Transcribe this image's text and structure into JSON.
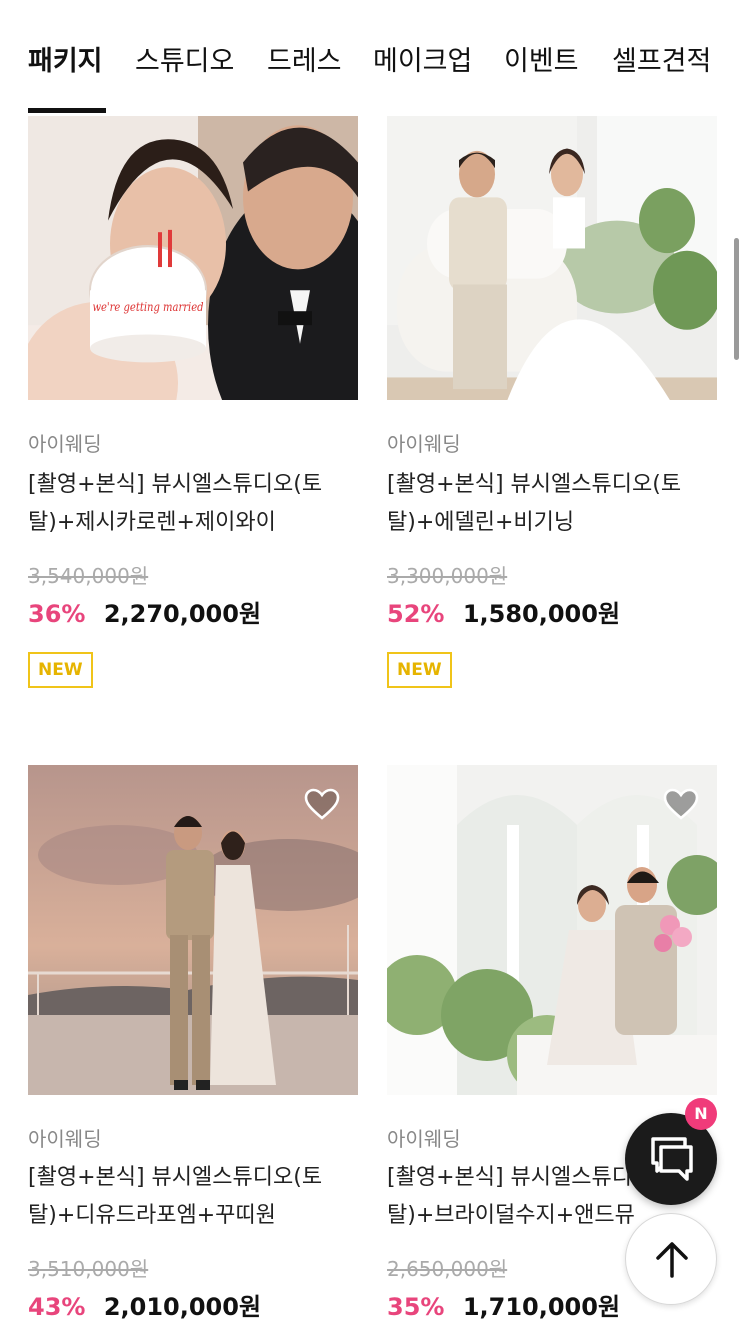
{
  "tabs": [
    {
      "label": "패키지",
      "active": true
    },
    {
      "label": "스튜디오"
    },
    {
      "label": "드레스"
    },
    {
      "label": "메이크업"
    },
    {
      "label": "이벤트"
    },
    {
      "label": "셀프견적"
    }
  ],
  "products": [
    {
      "vendor": "아이웨딩",
      "title_line1": "[촬영+본식] 뷰시엘스튜디오(토",
      "title_line2": "탈)+제시카로렌+제이와이",
      "original_price": "3,540,000원",
      "discount": "36%",
      "sale_price": "2,270,000원",
      "badge": "NEW",
      "cake_text": "we're getting married"
    },
    {
      "vendor": "아이웨딩",
      "title_line1": "[촬영+본식] 뷰시엘스튜디오(토",
      "title_line2": "탈)+에델린+비기닝",
      "original_price": "3,300,000원",
      "discount": "52%",
      "sale_price": "1,580,000원",
      "badge": "NEW"
    },
    {
      "vendor": "아이웨딩",
      "title_line1": "[촬영+본식] 뷰시엘스튜디오(토",
      "title_line2": "탈)+디유드라포엠+꾸띠원",
      "original_price": "3,510,000원",
      "discount": "43%",
      "sale_price": "2,010,000원"
    },
    {
      "vendor": "아이웨딩",
      "title_line1": "[촬영+본식] 뷰시엘스튜디오(토",
      "title_line2": "탈)+브라이덜수지+앤드뮤",
      "original_price": "2,650,000원",
      "discount": "35%",
      "sale_price": "1,710,000원"
    }
  ],
  "floating": {
    "chat_badge": "N",
    "chat_icon": "chat-bubbles-icon",
    "top_icon": "arrow-up-icon"
  },
  "colors": {
    "discount": "#e8457c",
    "badge_border": "#f0c419",
    "chat_bg": "#1b1b1b",
    "chat_badge": "#f03b7a"
  }
}
